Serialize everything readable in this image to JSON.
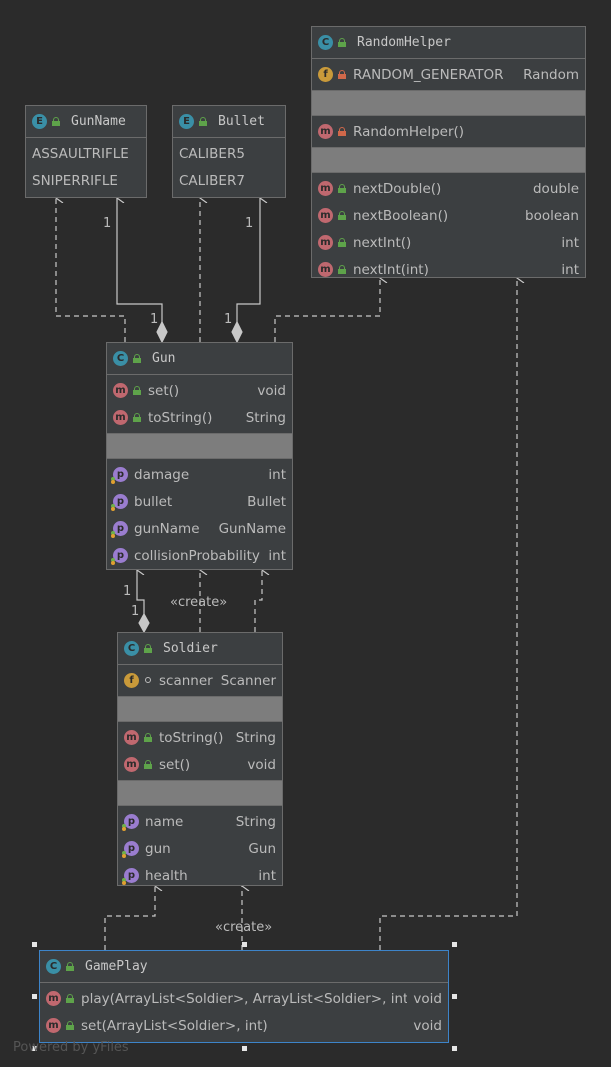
{
  "classes": {
    "random_helper": {
      "kind": "C",
      "name": "RandomHelper",
      "fields": [
        {
          "icon": "f",
          "label": "RANDOM_GENERATOR",
          "type": "Random"
        }
      ],
      "constructors": [
        {
          "icon": "m",
          "label": "RandomHelper()",
          "type": ""
        }
      ],
      "methods": [
        {
          "icon": "m",
          "label": "nextDouble()",
          "type": "double"
        },
        {
          "icon": "m",
          "label": "nextBoolean()",
          "type": "boolean"
        },
        {
          "icon": "m",
          "label": "nextInt()",
          "type": "int"
        },
        {
          "icon": "m",
          "label": "nextInt(int)",
          "type": "int"
        }
      ]
    },
    "gun_name": {
      "kind": "E",
      "name": "GunName",
      "constants": [
        "ASSAULTRIFLE",
        "SNIPERRIFLE"
      ]
    },
    "bullet": {
      "kind": "E",
      "name": "Bullet",
      "constants": [
        "CALIBER5",
        "CALIBER7"
      ]
    },
    "gun": {
      "kind": "C",
      "name": "Gun",
      "methods": [
        {
          "icon": "m",
          "label": "set()",
          "type": "void"
        },
        {
          "icon": "m",
          "label": "toString()",
          "type": "String"
        }
      ],
      "properties": [
        {
          "icon": "p",
          "label": "damage",
          "type": "int"
        },
        {
          "icon": "p",
          "label": "bullet",
          "type": "Bullet"
        },
        {
          "icon": "p",
          "label": "gunName",
          "type": "GunName"
        },
        {
          "icon": "p",
          "label": "collisionProbability",
          "type": "int"
        }
      ]
    },
    "soldier": {
      "kind": "C",
      "name": "Soldier",
      "fields": [
        {
          "icon": "f",
          "label": "scanner",
          "type": "Scanner"
        }
      ],
      "methods": [
        {
          "icon": "m",
          "label": "toString()",
          "type": "String"
        },
        {
          "icon": "m",
          "label": "set()",
          "type": "void"
        }
      ],
      "properties": [
        {
          "icon": "p",
          "label": "name",
          "type": "String"
        },
        {
          "icon": "p",
          "label": "gun",
          "type": "Gun"
        },
        {
          "icon": "p",
          "label": "health",
          "type": "int"
        }
      ]
    },
    "game_play": {
      "kind": "C",
      "name": "GamePlay",
      "methods": [
        {
          "icon": "m",
          "label": "play(ArrayList<Soldier>, ArrayList<Soldier>, int)",
          "type": "void"
        },
        {
          "icon": "m",
          "label": "set(ArrayList<Soldier>, int)",
          "type": "void"
        }
      ]
    }
  },
  "edge_labels": {
    "gunname_mult_top": "1",
    "gunname_mult_bottom": "1",
    "bullet_mult_top": "1",
    "bullet_mult_bottom": "1",
    "gun_soldier_mult_a": "1",
    "gun_soldier_mult_b": "1",
    "gun_create": "«create»",
    "soldier_create": "«create»"
  },
  "watermark": "Powered by yFiles",
  "colors": {
    "background": "#2b2b2b",
    "box_fill": "#3c3f41",
    "box_border": "#6b6b6b",
    "selected_border": "#3d84c9",
    "connector": "#c8c8c8"
  }
}
